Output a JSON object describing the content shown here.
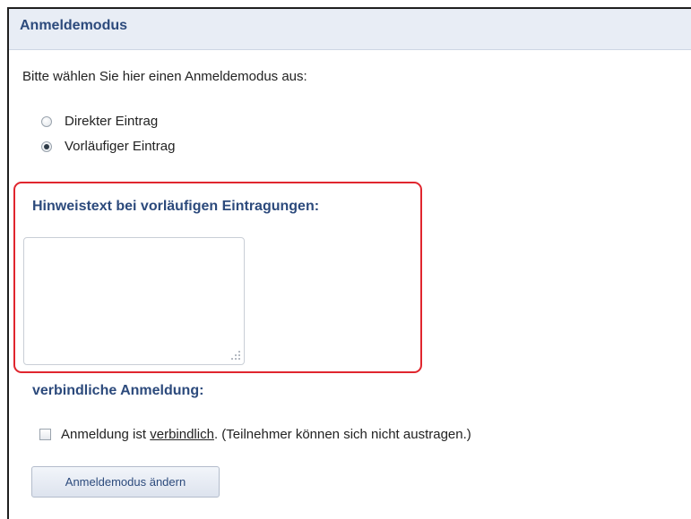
{
  "panel": {
    "title": "Anmeldemodus",
    "intro": "Bitte wählen Sie hier einen Anmeldemodus aus:"
  },
  "mode_options": [
    {
      "label": "Direkter Eintrag",
      "selected": false
    },
    {
      "label": "Vorläufiger Eintrag",
      "selected": true
    }
  ],
  "hint_section": {
    "label": "Hinweistext bei vorläufigen Eintragungen:",
    "textarea_value": ""
  },
  "binding_section": {
    "label": "verbindliche Anmeldung:",
    "checkbox_checked": false,
    "checkbox_text_before": "Anmeldung ist ",
    "checkbox_text_link": "verbindlich",
    "checkbox_text_after": ". (Teilnehmer können sich nicht austragen.)"
  },
  "actions": {
    "submit_label": "Anmeldemodus ändern"
  },
  "colors": {
    "heading": "#2c4a7c",
    "highlight": "#e0262e",
    "header_bg": "#e8edf5"
  }
}
